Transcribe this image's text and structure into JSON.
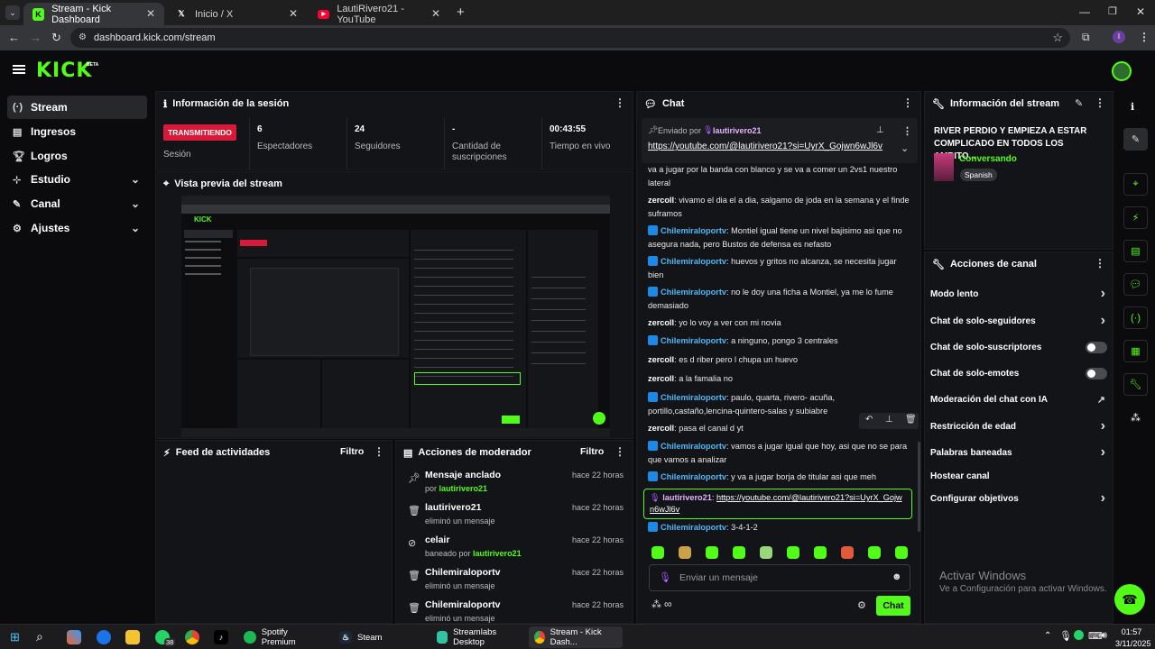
{
  "browser": {
    "tabs": [
      {
        "title": "Stream - Kick Dashboard"
      },
      {
        "title": "Inicio / X"
      },
      {
        "title": "LautiRivero21 - YouTube"
      }
    ],
    "url": "dashboard.kick.com/stream"
  },
  "header": {
    "logo": "KICK",
    "logo_beta": "BETA"
  },
  "sidebar": {
    "items": [
      {
        "label": "Stream"
      },
      {
        "label": "Ingresos"
      },
      {
        "label": "Logros"
      },
      {
        "label": "Estudio"
      },
      {
        "label": "Canal"
      },
      {
        "label": "Ajustes"
      }
    ]
  },
  "session": {
    "title": "Información de la sesión",
    "live_badge": "TRANSMITIENDO",
    "session_label": "Sesión",
    "stats": [
      {
        "value": "6",
        "label": "Espectadores"
      },
      {
        "value": "24",
        "label": "Seguidores"
      },
      {
        "value": "-",
        "label": "Cantidad de suscripciones"
      },
      {
        "value": "00:43:55",
        "label": "Tiempo en vivo"
      }
    ]
  },
  "preview": {
    "title": "Vista previa del stream"
  },
  "activity": {
    "title": "Feed de actividades",
    "filter": "Filtro"
  },
  "mod": {
    "title": "Acciones de moderador",
    "filter": "Filtro",
    "items": [
      {
        "title": "Mensaje anclado",
        "sub_prefix": "por ",
        "sub_user": "lautirivero21",
        "sub_suffix": "",
        "time": "hace 22 horas",
        "icon": "pin-icon"
      },
      {
        "title": "lautirivero21",
        "sub_prefix": "eliminó un mensaje",
        "sub_user": "",
        "sub_suffix": "",
        "time": "hace 22 horas",
        "icon": "trash-icon"
      },
      {
        "title": "celair",
        "sub_prefix": "baneado por ",
        "sub_user": "lautirivero21",
        "sub_suffix": "",
        "time": "hace 22 horas",
        "icon": "ban-icon"
      },
      {
        "title": "Chilemiraloportv",
        "sub_prefix": "eliminó un mensaje",
        "sub_user": "",
        "sub_suffix": "",
        "time": "hace 22 horas",
        "icon": "trash-icon"
      },
      {
        "title": "Chilemiraloportv",
        "sub_prefix": "eliminó un mensaje",
        "sub_user": "",
        "sub_suffix": "",
        "time": "hace 22 horas",
        "icon": "trash-icon"
      }
    ]
  },
  "chat": {
    "title": "Chat",
    "pinned": {
      "sent_by": "Enviado por",
      "user": "lautirivero21",
      "link": "https://youtube.com/@lautirivero21?si=UyrX_Gojwn6wJl6v"
    },
    "messages": [
      {
        "user": "",
        "text": "va a jugar por la banda con blanco y se va a comer un 2vs1 nuestro lateral",
        "badge": false
      },
      {
        "user": "zercoll",
        "text": ": vivamo el dia el a dia, salgamo de joda en la semana y el finde suframos",
        "badge": false
      },
      {
        "user": "Chilemiraloportv",
        "text": ": Montiel igual tiene un nivel bajisimo asi que no asegura nada, pero Bustos de defensa es nefasto",
        "badge": true
      },
      {
        "user": "Chilemiraloportv",
        "text": ": huevos y gritos no alcanza, se necesita jugar bien",
        "badge": true
      },
      {
        "user": "Chilemiraloportv",
        "text": ": no le doy una ficha a Montiel, ya me lo fume demasiado",
        "badge": true
      },
      {
        "user": "zercoll",
        "text": ": yo lo voy a ver con mi novia",
        "badge": false
      },
      {
        "user": "Chilemiraloportv",
        "text": ": a ninguno, pongo 3 centrales",
        "badge": true
      },
      {
        "user": "zercoll",
        "text": ": es d riber pero l chupa un huevo",
        "badge": false
      },
      {
        "user": "zercoll",
        "text": ": a la famalia no",
        "badge": false
      },
      {
        "user": "Chilemiraloportv",
        "text": ": paulo, quarta, rivero- acuña, portillo,castaño,lencina-quintero-salas y subiabre",
        "badge": true
      },
      {
        "user": "zercoll",
        "text": ": pasa el canal d yt",
        "badge": false
      },
      {
        "user": "Chilemiraloportv",
        "text": ": vamos a jugar igual que hoy, asi que no se para que vamos a analizar",
        "badge": true
      },
      {
        "user": "Chilemiraloportv",
        "text": ": y va a jugar borja de titular asi que meh",
        "badge": true
      },
      {
        "user": "lautirivero21",
        "text": "https://youtube.com/@lautirivero21?si=UyrX_Gojwn6wJl6v",
        "badge": false
      },
      {
        "user": "Chilemiraloportv",
        "text": ": 3-4-1-2",
        "badge": true
      }
    ],
    "input_placeholder": "Enviar un mensaje",
    "send_label": "Chat"
  },
  "stream_info": {
    "title": "Información del stream",
    "stream_title": "RIVER PERDIO Y EMPIEZA A ESTAR COMPLICADO EN TODOS LOS AMBITO...",
    "category": "Conversando",
    "language": "Spanish"
  },
  "channel_actions": {
    "title": "Acciones de canal",
    "items": [
      {
        "label": "Modo lento",
        "control": "chevron"
      },
      {
        "label": "Chat de solo-seguidores",
        "control": "chevron"
      },
      {
        "label": "Chat de solo-suscriptores",
        "control": "toggle"
      },
      {
        "label": "Chat de solo-emotes",
        "control": "toggle"
      },
      {
        "label": "Moderación del chat con IA",
        "control": "external"
      },
      {
        "label": "Restricción de edad",
        "control": "chevron"
      },
      {
        "label": "Palabras baneadas",
        "control": "chevron"
      },
      {
        "label": "Hostear canal",
        "control": "none"
      },
      {
        "label": "Configurar objetivos",
        "control": "chevron"
      }
    ]
  },
  "windows_watermark": {
    "line1": "Activar Windows",
    "line2": "Ve a Configuración para activar Windows."
  },
  "taskbar": {
    "apps": [
      {
        "label": "Spotify Premium"
      },
      {
        "label": "Steam"
      },
      {
        "label": "Streamlabs Desktop"
      },
      {
        "label": "Stream - Kick Dash..."
      }
    ],
    "whatsapp_badge": "38",
    "time": "01:57",
    "date": "3/11/2025"
  },
  "colors": {
    "accent": "#53fc18",
    "live_badge": "#d71a3a",
    "panel": "#131417"
  }
}
